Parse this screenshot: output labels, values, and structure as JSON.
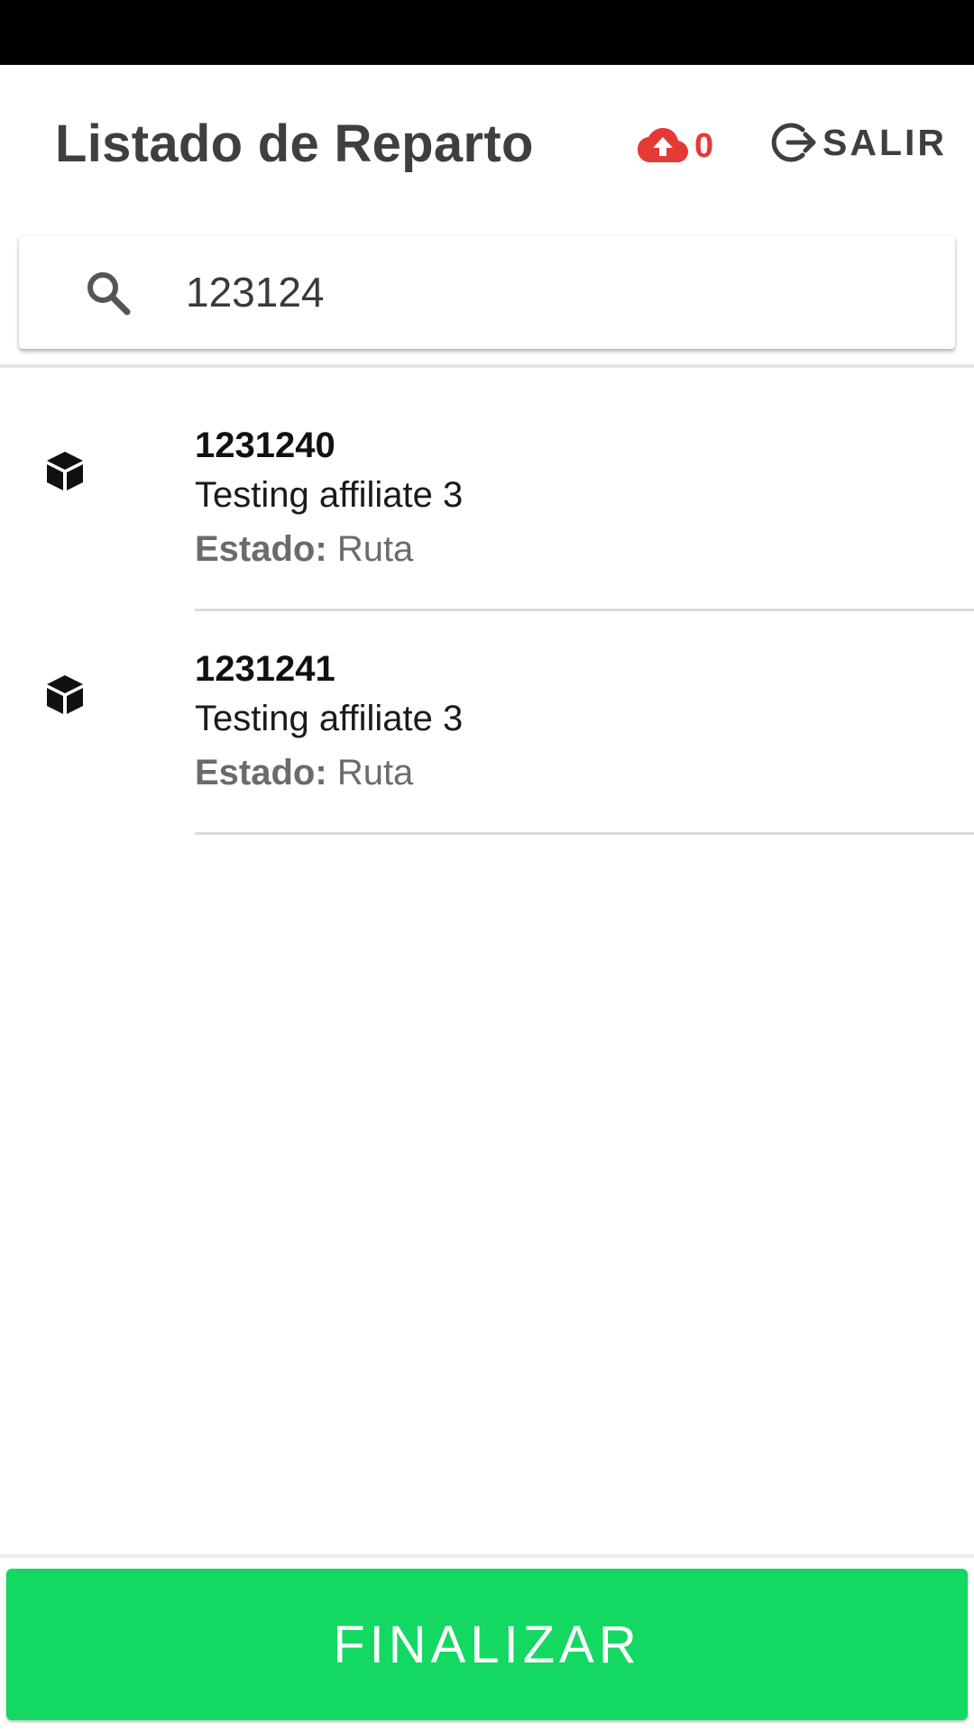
{
  "header": {
    "title": "Listado de Reparto",
    "sync_count": "0",
    "logout_label": "SALIR"
  },
  "search": {
    "value": "123124",
    "icon": "search-icon"
  },
  "items": [
    {
      "code": "1231240",
      "name": "Testing affiliate 3",
      "status_label": "Estado:",
      "status_value": "Ruta",
      "icon": "package-icon"
    },
    {
      "code": "1231241",
      "name": "Testing affiliate 3",
      "status_label": "Estado:",
      "status_value": "Ruta",
      "icon": "package-icon"
    }
  ],
  "footer": {
    "finalize_label": "FINALIZAR"
  },
  "colors": {
    "accent_green": "#13d862",
    "sync_red": "#e53935",
    "title_text": "#3f3f3f",
    "status_bar": "#000000"
  }
}
